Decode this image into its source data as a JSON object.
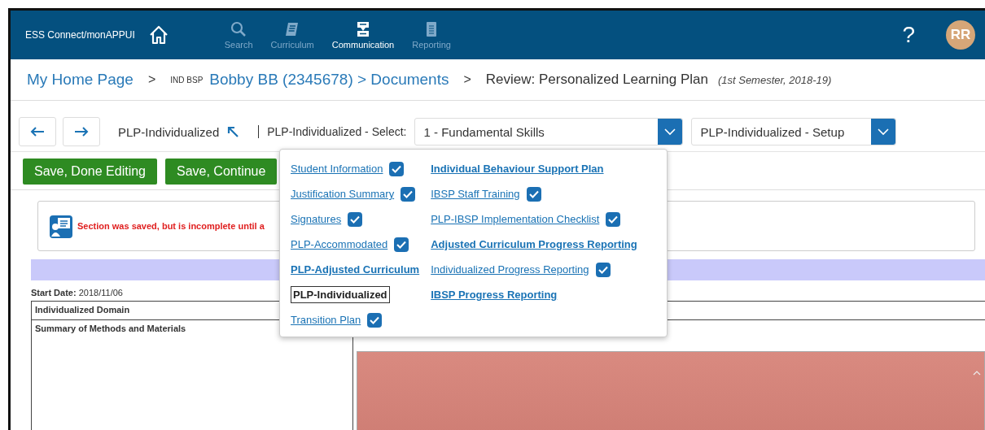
{
  "nav": {
    "brand": "ESS Connect/monAPPUI",
    "items": [
      {
        "label": "Search",
        "selected": false
      },
      {
        "label": "Curriculum",
        "selected": false
      },
      {
        "label": "Communication",
        "selected": true
      },
      {
        "label": "Reporting",
        "selected": false
      }
    ],
    "help": "?",
    "avatar": "RR"
  },
  "breadcrumb": {
    "home": "My Home Page",
    "sep1": ">",
    "tag": "IND BSP",
    "student": "Bobby BB (2345678) > Documents",
    "sep2": ">",
    "page": "Review: Personalized Learning Plan",
    "term": "(1st Semester, 2018-19)"
  },
  "toolbar": {
    "current": "PLP-Individualized",
    "select_label": "PLP-Individualized - Select:",
    "select_value": "1 - Fundamental Skills",
    "setup_value": "PLP-Individualized - Setup"
  },
  "buttons": [
    "Save, Done Editing",
    "Save, Continue"
  ],
  "message": "Section was saved, but is incomplete until a",
  "form": {
    "start_label": "Start Date:",
    "start_value": "2018/11/06",
    "rows": [
      "Individualized Domain",
      "Summary of Methods and Materials"
    ]
  },
  "menu": {
    "columns": [
      [
        {
          "label": "Student Information",
          "kind": "link",
          "checked": true
        },
        {
          "label": "Justification Summary",
          "kind": "link",
          "checked": true
        },
        {
          "label": "Signatures",
          "kind": "link",
          "checked": true
        },
        {
          "label": "PLP-Accommodated",
          "kind": "link",
          "checked": true
        },
        {
          "label": "PLP-Adjusted Curriculum",
          "kind": "heading"
        },
        {
          "label": "PLP-Individualized",
          "kind": "current"
        },
        {
          "label": "Transition Plan",
          "kind": "link",
          "checked": true
        }
      ],
      [
        {
          "label": "Individual Behaviour Support Plan",
          "kind": "heading"
        },
        {
          "label": "IBSP Staff Training",
          "kind": "link",
          "checked": true
        },
        {
          "label": "PLP-IBSP Implementation Checklist",
          "kind": "link",
          "checked": true
        },
        {
          "label": "Adjusted Curriculum Progress Reporting",
          "kind": "heading"
        },
        {
          "label": "Individualized Progress Reporting",
          "kind": "link",
          "checked": true
        },
        {
          "label": "IBSP Progress Reporting",
          "kind": "heading"
        }
      ]
    ]
  }
}
